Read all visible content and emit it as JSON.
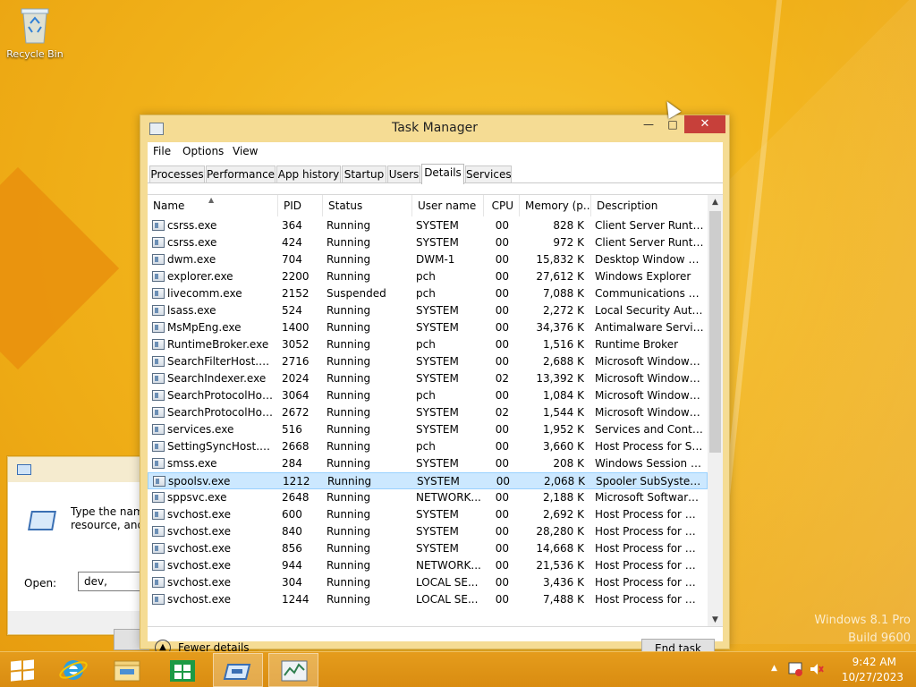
{
  "desktop": {
    "recycle_bin_label": "Recycle Bin",
    "watermark_line1": "Windows 8.1 Pro",
    "watermark_line2": "Build 9600"
  },
  "run_dialog": {
    "description": "Type the name\nresource, and W",
    "open_label": "Open:",
    "open_value": "dev,"
  },
  "task_manager": {
    "title": "Task Manager",
    "minimize": "—",
    "maximize": "□",
    "close": "✕",
    "menu": [
      "File",
      "Options",
      "View"
    ],
    "tabs": [
      "Processes",
      "Performance",
      "App history",
      "Startup",
      "Users",
      "Details",
      "Services"
    ],
    "active_tab": "Details",
    "columns": [
      "Name",
      "PID",
      "Status",
      "User name",
      "CPU",
      "Memory (p...",
      "Description"
    ],
    "rows": [
      [
        "csrss.exe",
        "364",
        "Running",
        "SYSTEM",
        "00",
        "828 K",
        "Client Server Runtim..."
      ],
      [
        "csrss.exe",
        "424",
        "Running",
        "SYSTEM",
        "00",
        "972 K",
        "Client Server Runtim..."
      ],
      [
        "dwm.exe",
        "704",
        "Running",
        "DWM-1",
        "00",
        "15,832 K",
        "Desktop Window M..."
      ],
      [
        "explorer.exe",
        "2200",
        "Running",
        "pch",
        "00",
        "27,612 K",
        "Windows Explorer"
      ],
      [
        "livecomm.exe",
        "2152",
        "Suspended",
        "pch",
        "00",
        "7,088 K",
        "Communications Se..."
      ],
      [
        "lsass.exe",
        "524",
        "Running",
        "SYSTEM",
        "00",
        "2,272 K",
        "Local Security Auth..."
      ],
      [
        "MsMpEng.exe",
        "1400",
        "Running",
        "SYSTEM",
        "00",
        "34,376 K",
        "Antimalware Service..."
      ],
      [
        "RuntimeBroker.exe",
        "3052",
        "Running",
        "pch",
        "00",
        "1,516 K",
        "Runtime Broker"
      ],
      [
        "SearchFilterHost.exe",
        "2716",
        "Running",
        "SYSTEM",
        "00",
        "2,688 K",
        "Microsoft Windows ..."
      ],
      [
        "SearchIndexer.exe",
        "2024",
        "Running",
        "SYSTEM",
        "02",
        "13,392 K",
        "Microsoft Windows ..."
      ],
      [
        "SearchProtocolHost....",
        "3064",
        "Running",
        "pch",
        "00",
        "1,084 K",
        "Microsoft Windows ..."
      ],
      [
        "SearchProtocolHost....",
        "2672",
        "Running",
        "SYSTEM",
        "02",
        "1,544 K",
        "Microsoft Windows ..."
      ],
      [
        "services.exe",
        "516",
        "Running",
        "SYSTEM",
        "00",
        "1,952 K",
        "Services and Control..."
      ],
      [
        "SettingSyncHost.exe",
        "2668",
        "Running",
        "pch",
        "00",
        "3,660 K",
        "Host Process for Set..."
      ],
      [
        "smss.exe",
        "284",
        "Running",
        "SYSTEM",
        "00",
        "208 K",
        "Windows Session M..."
      ],
      [
        "spoolsv.exe",
        "1212",
        "Running",
        "SYSTEM",
        "00",
        "2,068 K",
        "Spooler SubSystem ..."
      ],
      [
        "sppsvc.exe",
        "2648",
        "Running",
        "NETWORK...",
        "00",
        "2,188 K",
        "Microsoft Software ..."
      ],
      [
        "svchost.exe",
        "600",
        "Running",
        "SYSTEM",
        "00",
        "2,692 K",
        "Host Process for Wi..."
      ],
      [
        "svchost.exe",
        "840",
        "Running",
        "SYSTEM",
        "00",
        "28,280 K",
        "Host Process for Wi..."
      ],
      [
        "svchost.exe",
        "856",
        "Running",
        "SYSTEM",
        "00",
        "14,668 K",
        "Host Process for Wi..."
      ],
      [
        "svchost.exe",
        "944",
        "Running",
        "NETWORK...",
        "00",
        "21,536 K",
        "Host Process for Wi..."
      ],
      [
        "svchost.exe",
        "304",
        "Running",
        "LOCAL SE...",
        "00",
        "3,436 K",
        "Host Process for Wi..."
      ],
      [
        "svchost.exe",
        "1244",
        "Running",
        "LOCAL SE...",
        "00",
        "7,488 K",
        "Host Process for Wi..."
      ]
    ],
    "selected_row": 15,
    "fewer_details": "Fewer details",
    "end_task": "End task"
  },
  "taskbar": {
    "items": [
      "start-icon",
      "internet-explorer-icon",
      "file-explorer-icon",
      "store-icon",
      "run-icon",
      "task-manager-icon"
    ],
    "time": "9:42 AM",
    "date": "10/27/2023"
  }
}
